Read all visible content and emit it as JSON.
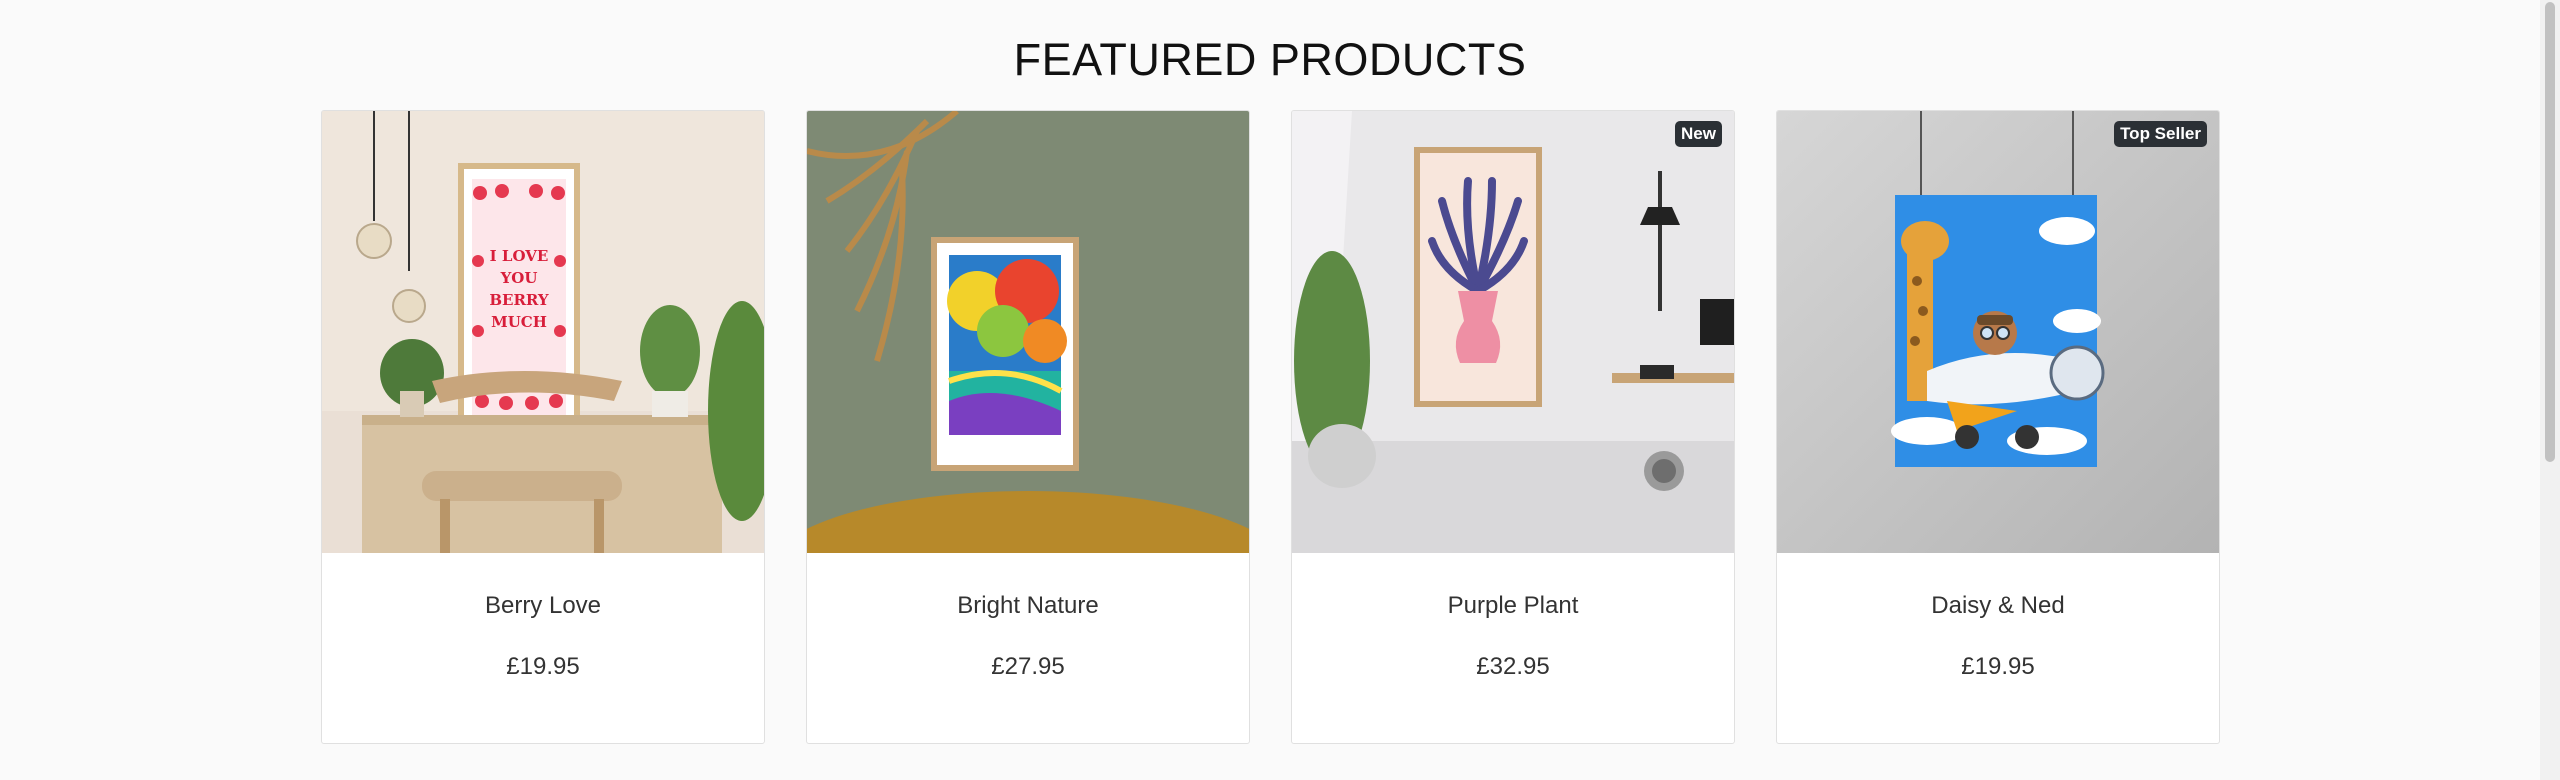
{
  "section": {
    "title": "FEATURED PRODUCTS"
  },
  "products": [
    {
      "name": "Berry Love",
      "price": "£19.95",
      "badge": "",
      "poster_lines": [
        "I LOVE",
        "YOU",
        "BERRY",
        "MUCH"
      ]
    },
    {
      "name": "Bright Nature",
      "price": "£27.95",
      "badge": ""
    },
    {
      "name": "Purple Plant",
      "price": "£32.95",
      "badge": "New"
    },
    {
      "name": "Daisy & Ned",
      "price": "£19.95",
      "badge": "Top Seller"
    }
  ],
  "colors": {
    "badge_bg": "#2b3035",
    "page_bg": "#fafafa",
    "card_border": "#e0e0e0"
  }
}
